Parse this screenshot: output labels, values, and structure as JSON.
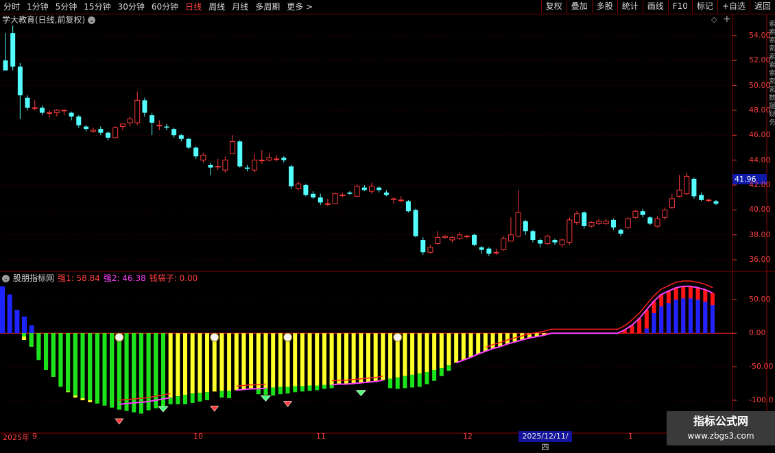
{
  "toolbar": {
    "periods": [
      "分时",
      "1分钟",
      "5分钟",
      "15分钟",
      "30分钟",
      "60分钟",
      "日线",
      "周线",
      "月线",
      "多周期",
      "更多 >"
    ],
    "active_period": "日线",
    "right_buttons": [
      "复权",
      "叠加",
      "多股",
      "统计",
      "画线",
      "F10",
      "标记",
      "+自选",
      "返回"
    ]
  },
  "main_chart": {
    "title": "学大教育(日线,前复权)",
    "last_price_tag": "41.96",
    "y_ticks": [
      "54.00",
      "52.00",
      "50.00",
      "48.00",
      "46.00",
      "44.00",
      "42.00",
      "40.00",
      "38.00",
      "36.00"
    ],
    "y_range": [
      35.4,
      55.2
    ],
    "up_color": "#ff3b3b",
    "down_color": "#54ffff",
    "candles": [
      [
        52,
        51.2,
        54.2,
        51.5
      ],
      [
        54.2,
        51.5,
        54.8,
        51.2
      ],
      [
        51.5,
        49.2,
        51.8,
        47.3
      ],
      [
        49,
        48.2,
        49.2,
        48
      ],
      [
        48.2,
        48.2,
        48.8,
        48
      ],
      [
        48.2,
        47.8,
        48.4,
        47.6
      ],
      [
        47.8,
        47.8,
        48,
        47.4
      ],
      [
        47.8,
        48,
        48.1,
        47.5
      ],
      [
        48,
        48,
        48.1,
        47.6
      ],
      [
        47.8,
        47.5,
        47.9,
        47.2
      ],
      [
        47.5,
        46.8,
        47.6,
        46.6
      ],
      [
        46.7,
        46.5,
        46.8,
        46.3
      ],
      [
        46.3,
        46.4,
        46.6,
        46.2
      ],
      [
        46.5,
        46.2,
        46.7,
        46
      ],
      [
        46.2,
        45.8,
        46.3,
        45.6
      ],
      [
        45.8,
        46.6,
        46.7,
        45.8
      ],
      [
        46.7,
        46.9,
        46.9,
        46.4
      ],
      [
        47,
        47.3,
        47.5,
        46.7
      ],
      [
        47,
        48.8,
        49.5,
        46.8
      ],
      [
        48.8,
        47.8,
        49,
        47.5
      ],
      [
        47.6,
        47,
        47.8,
        46
      ],
      [
        46.8,
        46.8,
        47.2,
        46.4
      ],
      [
        46.7,
        46.6,
        46.9,
        46.4
      ],
      [
        46.5,
        46,
        46.6,
        45.8
      ],
      [
        46,
        45.7,
        46.1,
        45.5
      ],
      [
        45.7,
        45,
        45.8,
        44.9
      ],
      [
        45,
        44.3,
        45.1,
        44.1
      ],
      [
        44,
        44.4,
        44.6,
        43.8
      ],
      [
        43.6,
        43.4,
        43.8,
        42.8
      ],
      [
        43.5,
        43.5,
        44.1,
        43.2
      ],
      [
        43.2,
        44,
        44.3,
        43
      ],
      [
        44.5,
        45.5,
        46,
        44.5
      ],
      [
        45.5,
        43.5,
        45.6,
        43.4
      ],
      [
        43.4,
        43.3,
        43.6,
        43.1
      ],
      [
        43.2,
        44,
        44.5,
        43
      ],
      [
        44,
        44,
        44.8,
        43.7
      ],
      [
        44,
        44.2,
        44.6,
        43.9
      ],
      [
        44.1,
        44.1,
        44.4,
        43.9
      ],
      [
        44.2,
        44,
        44.3,
        43.8
      ],
      [
        43.5,
        41.9,
        43.6,
        41.7
      ],
      [
        41.7,
        42.1,
        42.3,
        41.6
      ],
      [
        42,
        41.2,
        42.1,
        41.1
      ],
      [
        41.3,
        41,
        41.5,
        40.9
      ],
      [
        41,
        40.6,
        41.3,
        40.4
      ],
      [
        40.5,
        40.5,
        40.9,
        40.3
      ],
      [
        40.5,
        41.3,
        41.4,
        40.5
      ],
      [
        41.2,
        41.2,
        41.4,
        41
      ],
      [
        41.4,
        41.3,
        41.5,
        41.2
      ],
      [
        41.1,
        41.9,
        42.1,
        41
      ],
      [
        41.8,
        41.6,
        42,
        41.5
      ],
      [
        41.5,
        41.9,
        42.2,
        41.3
      ],
      [
        41.8,
        41.6,
        41.9,
        41.4
      ],
      [
        41.4,
        41.2,
        41.6,
        41.1
      ],
      [
        40.9,
        40.9,
        41,
        40.5
      ],
      [
        40.8,
        40.8,
        41.1,
        40.6
      ],
      [
        40.7,
        39.9,
        40.8,
        39.8
      ],
      [
        40,
        37.9,
        40.1,
        37.8
      ],
      [
        37.6,
        36.6,
        37.8,
        36.4
      ],
      [
        36.6,
        37,
        37.2,
        36.5
      ],
      [
        37.3,
        37.8,
        38.3,
        37.2
      ],
      [
        37.8,
        37.9,
        38,
        37.7
      ],
      [
        37.6,
        37.8,
        37.9,
        37.4
      ],
      [
        37.7,
        38,
        38.2,
        37.6
      ],
      [
        37.9,
        37.9,
        38,
        37.7
      ],
      [
        38,
        37.2,
        38.1,
        37.1
      ],
      [
        37,
        36.8,
        37.1,
        36.5
      ],
      [
        36.9,
        36.5,
        37,
        36.3
      ],
      [
        36.6,
        36.6,
        36.9,
        36.4
      ],
      [
        36.8,
        37.7,
        37.9,
        36.7
      ],
      [
        37.5,
        38,
        39.4,
        37.5
      ],
      [
        37.9,
        39.8,
        41.6,
        37.8
      ],
      [
        39.1,
        38.3,
        39.2,
        38
      ],
      [
        38.3,
        37.6,
        38.4,
        37.4
      ],
      [
        37.6,
        37.3,
        37.7,
        37
      ],
      [
        37.3,
        37.9,
        38,
        37.2
      ],
      [
        37.6,
        37.4,
        37.7,
        37.2
      ],
      [
        37.2,
        37.6,
        37.7,
        37
      ],
      [
        37.4,
        39.2,
        39.4,
        37.2
      ],
      [
        39,
        39.7,
        39.9,
        38.8
      ],
      [
        39.8,
        38.7,
        39.9,
        38.5
      ],
      [
        38.7,
        39,
        39.1,
        38.6
      ],
      [
        38.9,
        39.1,
        39.3,
        38.8
      ],
      [
        38.9,
        39.1,
        39.3,
        38.8
      ],
      [
        39.2,
        38.6,
        39.3,
        38.4
      ],
      [
        38.4,
        38.1,
        38.5,
        37.9
      ],
      [
        38.6,
        39.3,
        39.4,
        38.5
      ],
      [
        39.4,
        39.9,
        40,
        39.3
      ],
      [
        39.9,
        39.6,
        40.1,
        39.4
      ],
      [
        39.4,
        38.9,
        39.5,
        38.8
      ],
      [
        38.7,
        39.3,
        39.5,
        38.6
      ],
      [
        39.4,
        40,
        40.2,
        39.2
      ],
      [
        40.2,
        40.9,
        41.3,
        40.1
      ],
      [
        41.1,
        41.6,
        42.8,
        41
      ],
      [
        41.3,
        42.7,
        43,
        41.2
      ],
      [
        42.5,
        41.1,
        42.6,
        40.9
      ],
      [
        41.2,
        40.8,
        41.4,
        40.7
      ],
      [
        40.8,
        40.8,
        40.9,
        40.6
      ],
      [
        40.7,
        40.5,
        40.8,
        40.4
      ]
    ]
  },
  "indicator": {
    "title": "股朋指标网",
    "q1_text": "强1: 58.84",
    "q2_text": "强2: 46.38",
    "q3_text": "钱袋子: 0.00",
    "y_ticks": [
      "50.00",
      "0.00",
      "-50.00",
      "-100.0"
    ],
    "y_range": [
      -145,
      78
    ],
    "bar_count": 97,
    "blue_start": [
      70,
      58,
      35,
      25,
      12
    ],
    "green_bars": [
      -5,
      -20,
      -40,
      -55,
      -65,
      -80,
      -87,
      -93,
      -97,
      -100,
      -105,
      -108,
      -111,
      -114,
      -116,
      -118,
      -120,
      -115,
      -112,
      -114
    ],
    "yellow_depths": [
      -10,
      -20,
      -35,
      -50,
      -65,
      -78,
      -88,
      -96,
      -100,
      -103,
      -104,
      -105,
      -106,
      -106,
      -105,
      -104,
      -103,
      -102,
      -100,
      -98,
      -96,
      -94,
      -92,
      -90,
      -89,
      -88,
      -87,
      -86,
      -86,
      -85,
      -84,
      -83,
      -83,
      -82,
      -81,
      -80,
      -80,
      -79,
      -79,
      -78,
      -78,
      -77,
      -77,
      -76,
      -76,
      -75,
      -74,
      -73,
      -72,
      -70,
      -68,
      -66,
      -64,
      -62,
      -60,
      -58,
      -55,
      -52,
      -48,
      -44,
      -40,
      -36,
      -31,
      -27,
      -23,
      -20,
      -16,
      -13,
      -10,
      -7,
      -5,
      -3
    ],
    "red_bars": [
      5,
      12,
      22,
      35,
      48,
      58,
      63,
      68,
      70,
      70,
      68,
      65,
      60
    ],
    "markers": {
      "coin_bar_idx": [
        16,
        29,
        39,
        54
      ],
      "red_diamond_idx": [
        16,
        29,
        39
      ],
      "green_diamond_idx": [
        22,
        36,
        49
      ]
    }
  },
  "x_axis": {
    "labels": [
      "2025年",
      "9",
      "10",
      "11",
      "12",
      "1"
    ],
    "cursor_date": "2025/12/11/四"
  },
  "watermark": {
    "title": "指标公式网",
    "url": "www.zbgs3.com"
  }
}
